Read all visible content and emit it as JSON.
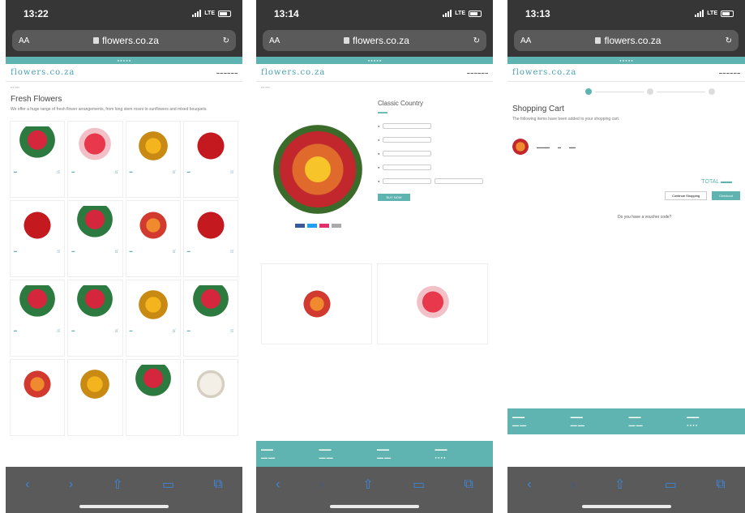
{
  "screens": [
    {
      "time": "13:22",
      "carrier": "LTE",
      "url_aa": "AA",
      "url": "flowers.co.za",
      "title": "Fresh Flowers",
      "description": "We offer a huge range of fresh flower arrangements, from long stem roses to sunflowers and mixed bouquets.",
      "cards": [
        "",
        "",
        "",
        "",
        "",
        "",
        "",
        "",
        "",
        "",
        "",
        "",
        "",
        "",
        "",
        ""
      ]
    },
    {
      "time": "13:14",
      "carrier": "LTE",
      "url_aa": "AA",
      "url": "flowers.co.za",
      "product_title": "Classic Country",
      "buy_label": "BUY NOW"
    },
    {
      "time": "13:13",
      "carrier": "LTE",
      "url_aa": "AA",
      "url": "flowers.co.za",
      "cart_title": "Shopping Cart",
      "cart_text": "The following items have been added to your shopping cart.",
      "total_label": "TOTAL",
      "continue_label": "Continue Shopping",
      "checkout_label": "Checkout",
      "coupon_label": "Do you have a voucher code?"
    }
  ]
}
